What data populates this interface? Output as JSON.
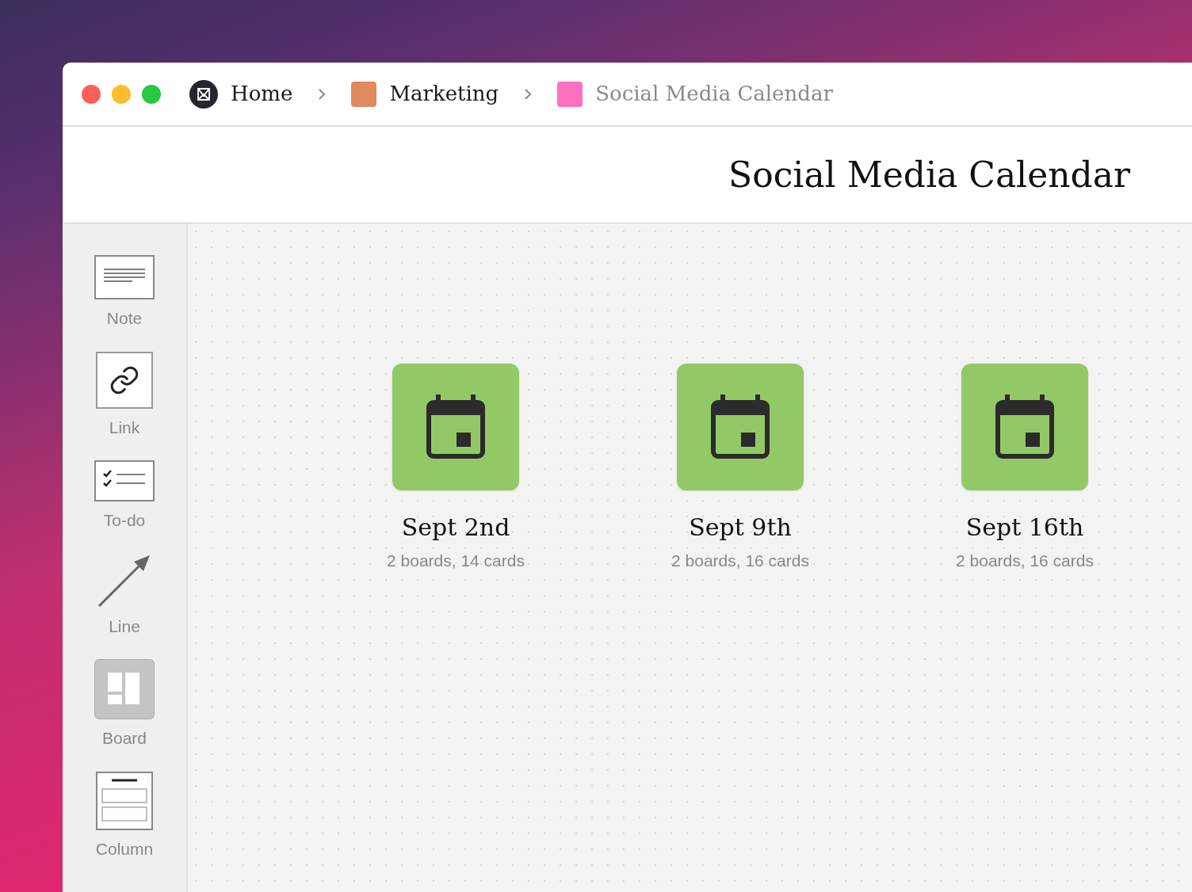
{
  "breadcrumb": [
    {
      "kind": "home",
      "label": "Home",
      "selected": false
    },
    {
      "kind": "board",
      "label": "Marketing",
      "color": "#e08a5f",
      "selected": false
    },
    {
      "kind": "board",
      "label": "Social Media Calendar",
      "color": "#ff70c0",
      "selected": true
    }
  ],
  "title": "Social Media Calendar",
  "tools": [
    {
      "kind": "note",
      "label": "Note"
    },
    {
      "kind": "link",
      "label": "Link"
    },
    {
      "kind": "todo",
      "label": "To-do"
    },
    {
      "kind": "line",
      "label": "Line"
    },
    {
      "kind": "board",
      "label": "Board"
    },
    {
      "kind": "column",
      "label": "Column"
    }
  ],
  "boards": [
    {
      "title": "Sept 2nd",
      "meta": "2 boards, 14 cards",
      "color": "#92c966"
    },
    {
      "title": "Sept 9th",
      "meta": "2 boards, 16 cards",
      "color": "#92c966"
    },
    {
      "title": "Sept 16th",
      "meta": "2 boards, 16 cards",
      "color": "#92c966"
    }
  ]
}
